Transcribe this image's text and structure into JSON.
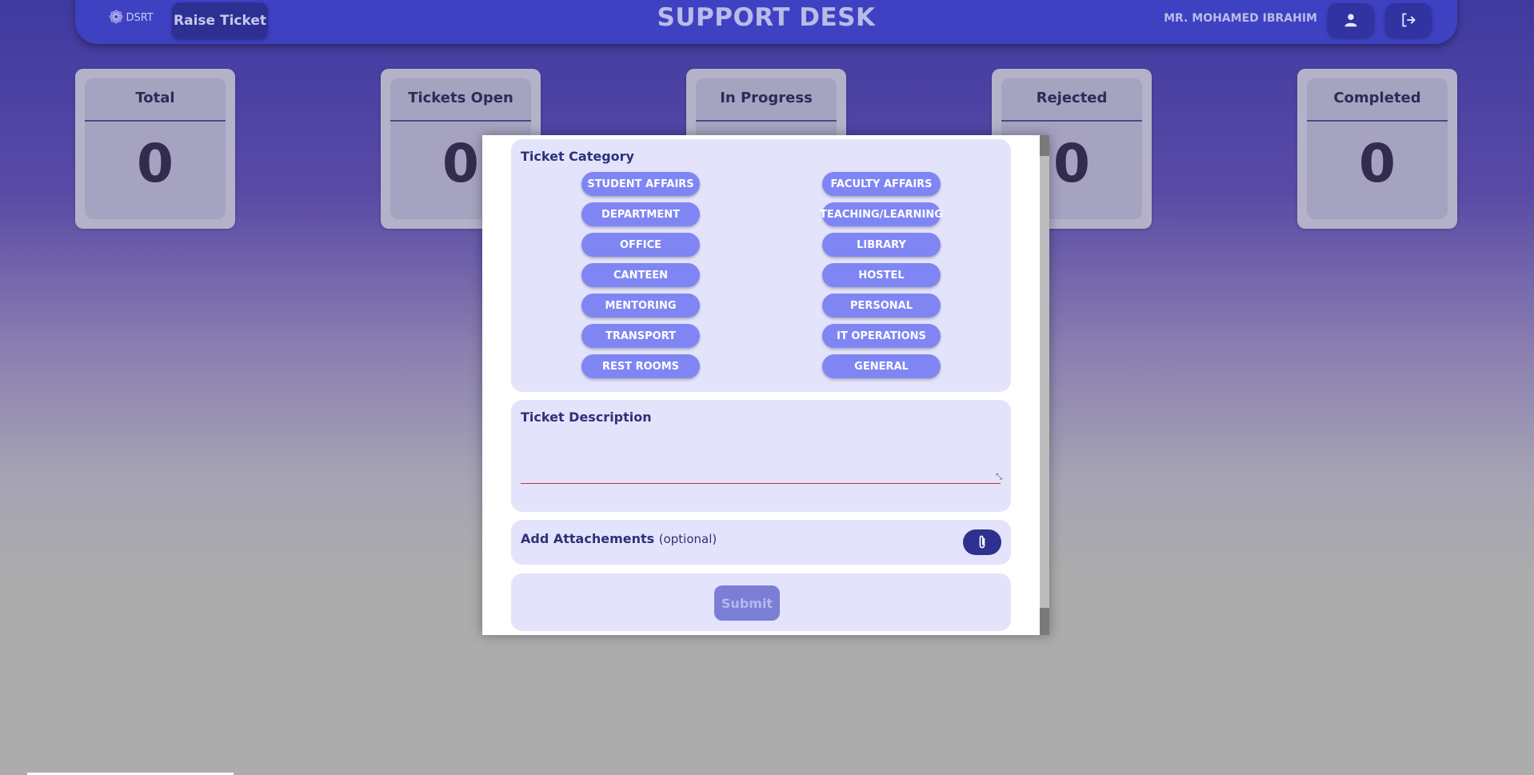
{
  "header": {
    "logo_text": "DSRT",
    "raise_ticket_label": "Raise Ticket",
    "title": "SUPPORT DESK",
    "username": "MR. MOHAMED IBRAHIM",
    "user_icon": "user-icon",
    "logout_icon": "logout-icon"
  },
  "stats": [
    {
      "label": "Total",
      "value": "0"
    },
    {
      "label": "Tickets Open",
      "value": "0"
    },
    {
      "label": "In Progress",
      "value": ""
    },
    {
      "label": "Rejected",
      "value": "0"
    },
    {
      "label": "Completed",
      "value": "0"
    }
  ],
  "modal": {
    "category_title": "Ticket Category",
    "categories_left": [
      "STUDENT AFFAIRS",
      "DEPARTMENT",
      "OFFICE",
      "CANTEEN",
      "MENTORING",
      "TRANSPORT",
      "REST ROOMS"
    ],
    "categories_right": [
      "FACULTY AFFAIRS",
      "TEACHING/LEARNING",
      "LIBRARY",
      "HOSTEL",
      "PERSONAL",
      "IT OPERATIONS",
      "GENERAL"
    ],
    "description_title": "Ticket Description",
    "description_value": "",
    "attachments_title": "Add Attachements",
    "attachments_optional": "(optional)",
    "attachment_icon": "paperclip-icon",
    "submit_label": "Submit"
  },
  "colors": {
    "header_bg": "#3e41c2",
    "pill_bg": "#7f86f4",
    "section_bg": "#e3e3fb",
    "accent_dark": "#2e3190"
  }
}
